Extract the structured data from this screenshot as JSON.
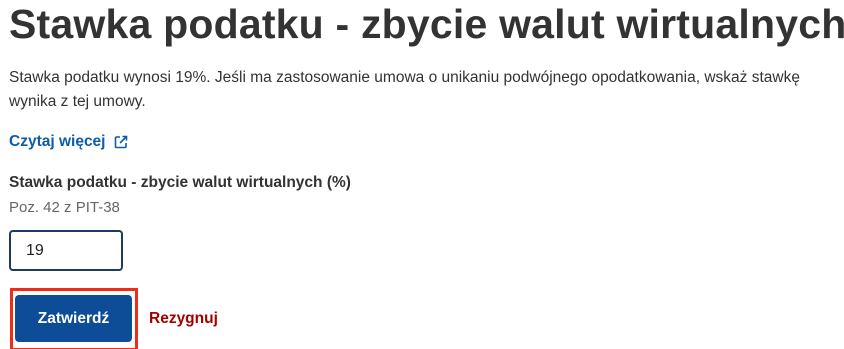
{
  "page": {
    "title": "Stawka podatku - zbycie walut wirtualnych",
    "description_line1": "Stawka podatku wynosi 19%. Jeśli ma zastosowanie umowa o unikaniu podwójnego opodatkowania, wskaż stawkę",
    "description_line2": "wynika z tej umowy."
  },
  "read_more": {
    "label": "Czytaj więcej",
    "icon": "external-link-icon"
  },
  "field": {
    "label": "Stawka podatku - zbycie walut wirtualnych (%)",
    "hint": "Poz. 42 z PIT-38",
    "value": "19"
  },
  "actions": {
    "confirm_label": "Zatwierdź",
    "cancel_label": "Rezygnuj"
  },
  "colors": {
    "text": "#333333",
    "link": "#0b5cad",
    "primary_button": "#0d4d97",
    "cancel_link": "#a30000",
    "highlight_border": "#f12b1b"
  }
}
